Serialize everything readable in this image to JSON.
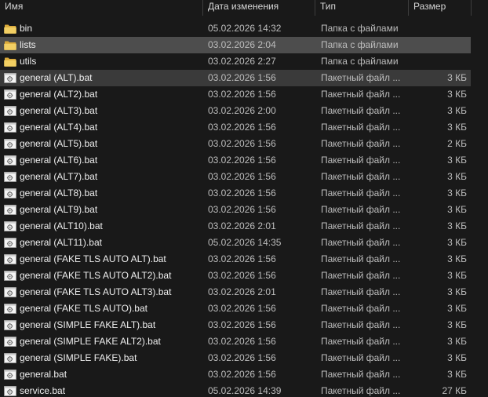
{
  "columns": {
    "name": "Имя",
    "date": "Дата изменения",
    "type": "Тип",
    "size": "Размер"
  },
  "rows": [
    {
      "name": "bin",
      "date": "05.02.2026 14:32",
      "type": "Папка с файлами",
      "size": "",
      "icon": "folder"
    },
    {
      "name": "lists",
      "date": "03.02.2026 2:04",
      "type": "Папка с файлами",
      "size": "",
      "icon": "folder"
    },
    {
      "name": "utils",
      "date": "03.02.2026 2:27",
      "type": "Папка с файлами",
      "size": "",
      "icon": "folder"
    },
    {
      "name": "general (ALT).bat",
      "date": "03.02.2026 1:56",
      "type": "Пакетный файл ...",
      "size": "3 КБ",
      "icon": "batch-file"
    },
    {
      "name": "general (ALT2).bat",
      "date": "03.02.2026 1:56",
      "type": "Пакетный файл ...",
      "size": "3 КБ",
      "icon": "batch-file"
    },
    {
      "name": "general (ALT3).bat",
      "date": "03.02.2026 2:00",
      "type": "Пакетный файл ...",
      "size": "3 КБ",
      "icon": "batch-file"
    },
    {
      "name": "general (ALT4).bat",
      "date": "03.02.2026 1:56",
      "type": "Пакетный файл ...",
      "size": "3 КБ",
      "icon": "batch-file"
    },
    {
      "name": "general (ALT5).bat",
      "date": "03.02.2026 1:56",
      "type": "Пакетный файл ...",
      "size": "2 КБ",
      "icon": "batch-file"
    },
    {
      "name": "general (ALT6).bat",
      "date": "03.02.2026 1:56",
      "type": "Пакетный файл ...",
      "size": "3 КБ",
      "icon": "batch-file"
    },
    {
      "name": "general (ALT7).bat",
      "date": "03.02.2026 1:56",
      "type": "Пакетный файл ...",
      "size": "3 КБ",
      "icon": "batch-file"
    },
    {
      "name": "general (ALT8).bat",
      "date": "03.02.2026 1:56",
      "type": "Пакетный файл ...",
      "size": "3 КБ",
      "icon": "batch-file"
    },
    {
      "name": "general (ALT9).bat",
      "date": "03.02.2026 1:56",
      "type": "Пакетный файл ...",
      "size": "3 КБ",
      "icon": "batch-file"
    },
    {
      "name": "general (ALT10).bat",
      "date": "03.02.2026 2:01",
      "type": "Пакетный файл ...",
      "size": "3 КБ",
      "icon": "batch-file"
    },
    {
      "name": "general (ALT11).bat",
      "date": "05.02.2026 14:35",
      "type": "Пакетный файл ...",
      "size": "3 КБ",
      "icon": "batch-file"
    },
    {
      "name": "general (FAKE TLS AUTO ALT).bat",
      "date": "03.02.2026 1:56",
      "type": "Пакетный файл ...",
      "size": "3 КБ",
      "icon": "batch-file"
    },
    {
      "name": "general (FAKE TLS AUTO ALT2).bat",
      "date": "03.02.2026 1:56",
      "type": "Пакетный файл ...",
      "size": "3 КБ",
      "icon": "batch-file"
    },
    {
      "name": "general (FAKE TLS AUTO ALT3).bat",
      "date": "03.02.2026 2:01",
      "type": "Пакетный файл ...",
      "size": "3 КБ",
      "icon": "batch-file"
    },
    {
      "name": "general (FAKE TLS AUTO).bat",
      "date": "03.02.2026 1:56",
      "type": "Пакетный файл ...",
      "size": "3 КБ",
      "icon": "batch-file"
    },
    {
      "name": "general (SIMPLE FAKE ALT).bat",
      "date": "03.02.2026 1:56",
      "type": "Пакетный файл ...",
      "size": "3 КБ",
      "icon": "batch-file"
    },
    {
      "name": "general (SIMPLE FAKE ALT2).bat",
      "date": "03.02.2026 1:56",
      "type": "Пакетный файл ...",
      "size": "3 КБ",
      "icon": "batch-file"
    },
    {
      "name": "general (SIMPLE FAKE).bat",
      "date": "03.02.2026 1:56",
      "type": "Пакетный файл ...",
      "size": "3 КБ",
      "icon": "batch-file"
    },
    {
      "name": "general.bat",
      "date": "03.02.2026 1:56",
      "type": "Пакетный файл ...",
      "size": "3 КБ",
      "icon": "batch-file"
    },
    {
      "name": "service.bat",
      "date": "05.02.2026 14:39",
      "type": "Пакетный файл ...",
      "size": "27 КБ",
      "icon": "batch-file"
    }
  ],
  "state": {
    "hovered_row": "lists",
    "selected_row": "general (ALT).bat"
  },
  "colors": {
    "background": "#191919",
    "selected": "#4d4d4d",
    "hover": "#3a3a3a",
    "folder": "#e8c45c"
  }
}
